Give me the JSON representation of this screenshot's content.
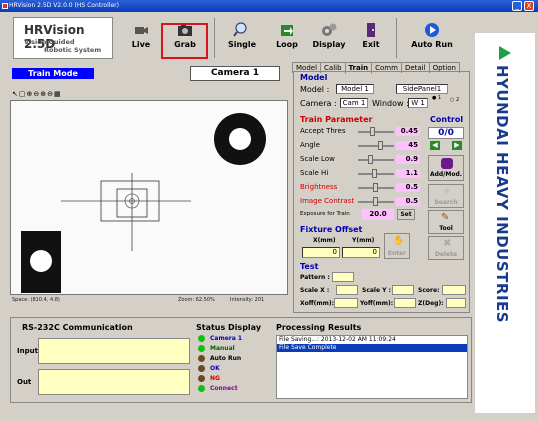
{
  "window": {
    "title": "HRVision 2.5D V2.0.0 (HS Controller)",
    "min": "_",
    "close": "X"
  },
  "logo": {
    "title": "HRVision 2.5D",
    "line1": "Vision Guided",
    "line2": "Robotic System"
  },
  "toolbar": {
    "live": "Live",
    "grab": "Grab",
    "single": "Single",
    "loop": "Loop",
    "display": "Display",
    "exit": "Exit",
    "autorun": "Auto Run"
  },
  "mode": {
    "label": "Train Mode",
    "camera": "Camera 1"
  },
  "image_status": {
    "space": "Space: (810.4, 4.8)",
    "zoom": "Zoom: 62.50%",
    "intensity": "Intensity: 201"
  },
  "tabs": [
    "Model",
    "Calib",
    "Train",
    "Comm",
    "Detail",
    "Option"
  ],
  "model": {
    "header": "Model",
    "model_label": "Model :",
    "model_value": "Model 1",
    "side_value": "SidePanel1",
    "camera_label": "Camera :",
    "camera_value": "Cam 1",
    "window_label": "Window :",
    "window_value": "W 1",
    "radio1": "1",
    "radio2": "2"
  },
  "train": {
    "header": "Train Parameter",
    "params": [
      {
        "label": "Accept Thres",
        "value": "0.45"
      },
      {
        "label": "Angle",
        "value": "45"
      },
      {
        "label": "Scale Low",
        "value": "0.9"
      },
      {
        "label": "Scale Hi",
        "value": "1.1"
      },
      {
        "label": "Brightness",
        "value": "0.5"
      },
      {
        "label": "Image Contrast",
        "value": "0.5"
      }
    ],
    "exposure_label": "Exposure for Train",
    "exposure_value": "20.0",
    "set": "Set"
  },
  "control": {
    "header": "Control",
    "count": "0/0",
    "addmod": "Add/Mod.",
    "search": "Search",
    "tool": "Tool",
    "delete": "Delete"
  },
  "fixture": {
    "header": "Fixture Offset",
    "x_label": "X(mm)",
    "y_label": "Y(mm)",
    "x": "0",
    "y": "0",
    "enter": "Enter"
  },
  "test": {
    "header": "Test",
    "pattern": "Pattern :",
    "scalex": "Scale X :",
    "scaley": "Scale Y :",
    "score": "Score:",
    "xoff": "Xoff(mm):",
    "yoff": "Yoff(mm):",
    "zdeg": "Z(Deg):"
  },
  "rs232": {
    "title": "RS-232C Communication",
    "input": "Input",
    "out": "Out"
  },
  "status": {
    "title": "Status Display",
    "items": [
      {
        "label": "Camera 1",
        "color": "#10c010",
        "text": "#0000cc"
      },
      {
        "label": "Manual",
        "color": "#10c010",
        "text": "#006000"
      },
      {
        "label": "Auto Run",
        "color": "#6a4a20",
        "text": "#000000"
      },
      {
        "label": "OK",
        "color": "#6a4a20",
        "text": "#0000cc"
      },
      {
        "label": "NG",
        "color": "#6a4a20",
        "text": "#cc0000"
      },
      {
        "label": "Connect",
        "color": "#10c010",
        "text": "#8000a0"
      }
    ]
  },
  "results": {
    "title": "Processing Results",
    "lines": [
      "File Saving...: 2013-12-02 AM 11:09:24",
      "File Save Complete"
    ]
  },
  "brand": {
    "name": "HYUNDAI HEAVY INDUSTRIES",
    "color": "#1a3a8c",
    "accent": "#20a040"
  }
}
